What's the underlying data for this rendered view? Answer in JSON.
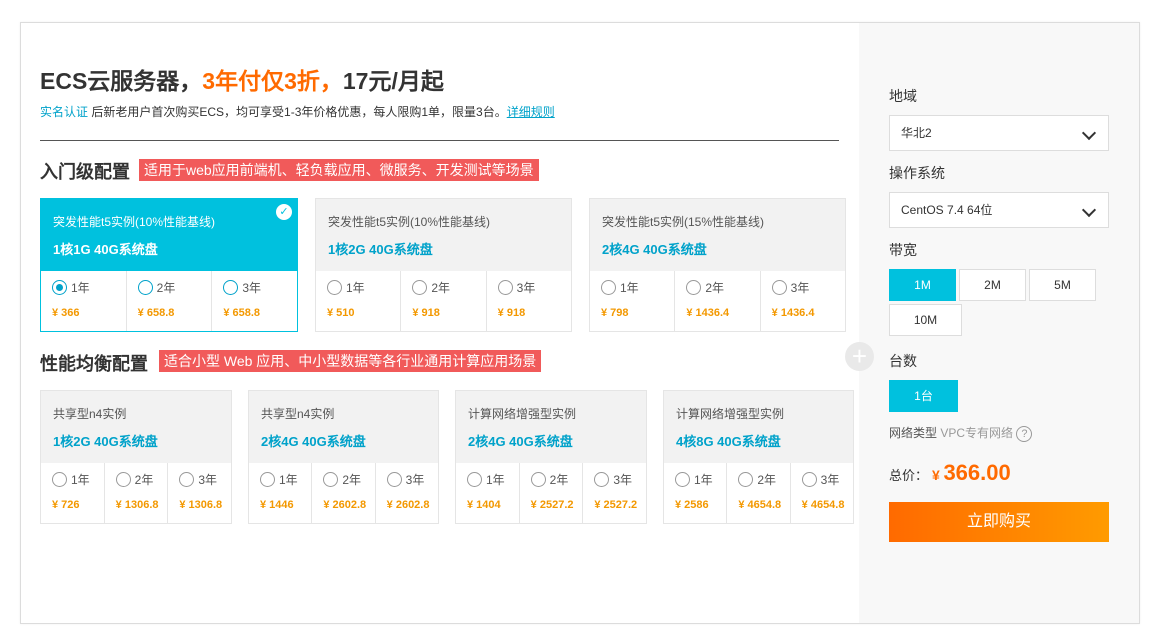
{
  "header": {
    "title_prefix": "ECS云服务器，",
    "title_highlight": "3年付仅3折，",
    "title_suffix": "17元/月起",
    "realname_link": "实名认证",
    "notice": " 后新老用户首次购买ECS，均可享受1-3年价格优惠，每人限购1单，限量3台。",
    "rules_link": "详细规则"
  },
  "sections": [
    {
      "title": "入门级配置",
      "tag": "适用于web应用前端机、轻负载应用、微服务、开发测试等场景",
      "cards": [
        {
          "type": "突发性能t5实例(10%性能基线)",
          "spec": "1核1G 40G系统盘",
          "selected": true,
          "options": [
            {
              "label": "1年",
              "price": "¥ 366"
            },
            {
              "label": "2年",
              "price": "¥ 658.8"
            },
            {
              "label": "3年",
              "price": "¥ 658.8"
            }
          ]
        },
        {
          "type": "突发性能t5实例(10%性能基线)",
          "spec": "1核2G 40G系统盘",
          "selected": false,
          "options": [
            {
              "label": "1年",
              "price": "¥ 510"
            },
            {
              "label": "2年",
              "price": "¥ 918"
            },
            {
              "label": "3年",
              "price": "¥ 918"
            }
          ]
        },
        {
          "type": "突发性能t5实例(15%性能基线)",
          "spec": "2核4G 40G系统盘",
          "selected": false,
          "options": [
            {
              "label": "1年",
              "price": "¥ 798"
            },
            {
              "label": "2年",
              "price": "¥ 1436.4"
            },
            {
              "label": "3年",
              "price": "¥ 1436.4"
            }
          ]
        }
      ]
    },
    {
      "title": "性能均衡配置",
      "tag": "适合小型 Web 应用、中小型数据等各行业通用计算应用场景",
      "cards": [
        {
          "type": "共享型n4实例",
          "spec": "1核2G 40G系统盘",
          "selected": false,
          "options": [
            {
              "label": "1年",
              "price": "¥ 726"
            },
            {
              "label": "2年",
              "price": "¥ 1306.8"
            },
            {
              "label": "3年",
              "price": "¥ 1306.8"
            }
          ]
        },
        {
          "type": "共享型n4实例",
          "spec": "2核4G 40G系统盘",
          "selected": false,
          "options": [
            {
              "label": "1年",
              "price": "¥ 1446"
            },
            {
              "label": "2年",
              "price": "¥ 2602.8"
            },
            {
              "label": "3年",
              "price": "¥ 2602.8"
            }
          ]
        },
        {
          "type": "计算网络增强型实例",
          "spec": "2核4G 40G系统盘",
          "selected": false,
          "options": [
            {
              "label": "1年",
              "price": "¥ 1404"
            },
            {
              "label": "2年",
              "price": "¥ 2527.2"
            },
            {
              "label": "3年",
              "price": "¥ 2527.2"
            }
          ]
        },
        {
          "type": "计算网络增强型实例",
          "spec": "4核8G 40G系统盘",
          "selected": false,
          "options": [
            {
              "label": "1年",
              "price": "¥ 2586"
            },
            {
              "label": "2年",
              "price": "¥ 4654.8"
            },
            {
              "label": "3年",
              "price": "¥ 4654.8"
            }
          ]
        }
      ]
    }
  ],
  "sidebar": {
    "region_label": "地域",
    "region_value": "华北2",
    "os_label": "操作系统",
    "os_value": "CentOS 7.4 64位",
    "bandwidth_label": "带宽",
    "bandwidth_options": [
      "1M",
      "2M",
      "5M",
      "10M"
    ],
    "bandwidth_selected": "1M",
    "count_label": "台数",
    "count_value": "1台",
    "network_label": "网络类型",
    "network_value": "VPC专有网络",
    "help_glyph": "?",
    "total_label": "总价：",
    "currency": "¥",
    "total_value": "366.00",
    "buy_label": "立即购买"
  },
  "colors": {
    "accent": "#00c1de",
    "price": "#f39800",
    "highlight": "#ff6a00",
    "tag": "#f15a5a"
  }
}
